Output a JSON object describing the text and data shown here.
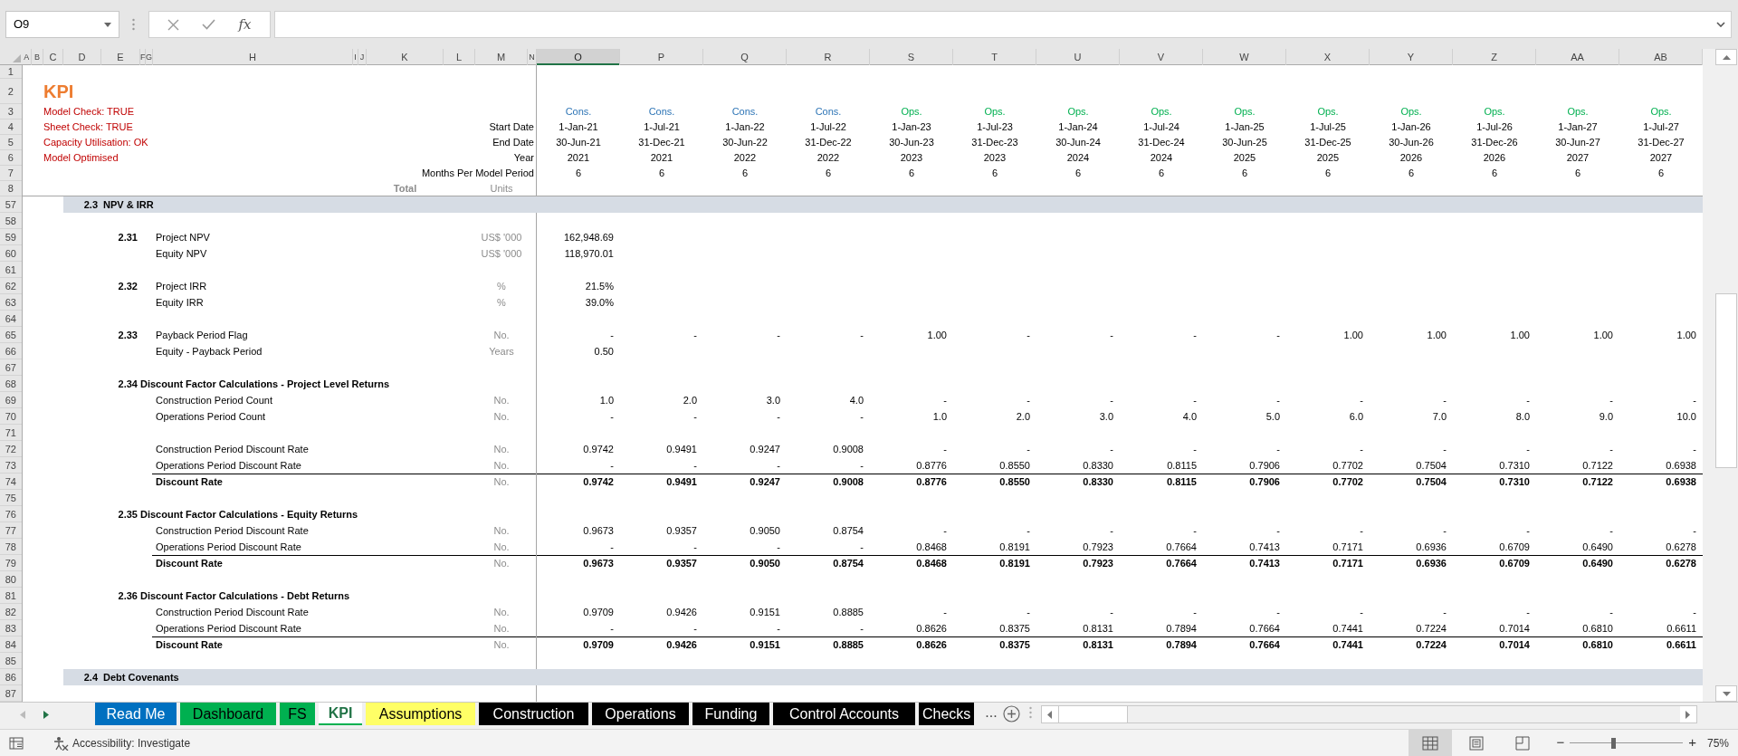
{
  "name_box": "O9",
  "formula_label": "fx",
  "columns": [
    {
      "letter": "A",
      "selected": false
    },
    {
      "letter": "B",
      "selected": false
    },
    {
      "letter": "C",
      "selected": false
    },
    {
      "letter": "D",
      "selected": false
    },
    {
      "letter": "E",
      "selected": false
    },
    {
      "letter": "F",
      "selected": false
    },
    {
      "letter": "G",
      "selected": false
    },
    {
      "letter": "H",
      "selected": false
    },
    {
      "letter": "I",
      "selected": false
    },
    {
      "letter": "J",
      "selected": false
    },
    {
      "letter": "K",
      "selected": false
    },
    {
      "letter": "L",
      "selected": false
    },
    {
      "letter": "M",
      "selected": false
    },
    {
      "letter": "N",
      "selected": false
    },
    {
      "letter": "O",
      "selected": true
    },
    {
      "letter": "P",
      "selected": false
    },
    {
      "letter": "Q",
      "selected": false
    },
    {
      "letter": "R",
      "selected": false
    },
    {
      "letter": "S",
      "selected": false
    },
    {
      "letter": "T",
      "selected": false
    },
    {
      "letter": "U",
      "selected": false
    },
    {
      "letter": "V",
      "selected": false
    },
    {
      "letter": "W",
      "selected": false
    },
    {
      "letter": "X",
      "selected": false
    },
    {
      "letter": "Y",
      "selected": false
    },
    {
      "letter": "Z",
      "selected": false
    },
    {
      "letter": "AA",
      "selected": false
    },
    {
      "letter": "AB",
      "selected": false
    }
  ],
  "frozen_rows": [
    "1",
    "2",
    "3",
    "4",
    "5",
    "6",
    "7",
    "8"
  ],
  "sheet_title": "KPI",
  "status_checks": [
    "Model Check: TRUE",
    "Sheet Check: TRUE",
    "Capacity Utilisation: OK",
    "Model Optimised"
  ],
  "timeline_labels": [
    "Start Date",
    "End Date",
    "Year",
    "Months Per Model Period"
  ],
  "total_label": "Total",
  "units_label": "Units",
  "periods": [
    {
      "phase": "Cons.",
      "kind": "cons",
      "start": "1-Jan-21",
      "end": "30-Jun-21",
      "year": "2021",
      "months": "6"
    },
    {
      "phase": "Cons.",
      "kind": "cons",
      "start": "1-Jul-21",
      "end": "31-Dec-21",
      "year": "2021",
      "months": "6"
    },
    {
      "phase": "Cons.",
      "kind": "cons",
      "start": "1-Jan-22",
      "end": "30-Jun-22",
      "year": "2022",
      "months": "6"
    },
    {
      "phase": "Cons.",
      "kind": "cons",
      "start": "1-Jul-22",
      "end": "31-Dec-22",
      "year": "2022",
      "months": "6"
    },
    {
      "phase": "Ops.",
      "kind": "ops",
      "start": "1-Jan-23",
      "end": "30-Jun-23",
      "year": "2023",
      "months": "6"
    },
    {
      "phase": "Ops.",
      "kind": "ops",
      "start": "1-Jul-23",
      "end": "31-Dec-23",
      "year": "2023",
      "months": "6"
    },
    {
      "phase": "Ops.",
      "kind": "ops",
      "start": "1-Jan-24",
      "end": "30-Jun-24",
      "year": "2024",
      "months": "6"
    },
    {
      "phase": "Ops.",
      "kind": "ops",
      "start": "1-Jul-24",
      "end": "31-Dec-24",
      "year": "2024",
      "months": "6"
    },
    {
      "phase": "Ops.",
      "kind": "ops",
      "start": "1-Jan-25",
      "end": "30-Jun-25",
      "year": "2025",
      "months": "6"
    },
    {
      "phase": "Ops.",
      "kind": "ops",
      "start": "1-Jul-25",
      "end": "31-Dec-25",
      "year": "2025",
      "months": "6"
    },
    {
      "phase": "Ops.",
      "kind": "ops",
      "start": "1-Jan-26",
      "end": "30-Jun-26",
      "year": "2026",
      "months": "6"
    },
    {
      "phase": "Ops.",
      "kind": "ops",
      "start": "1-Jul-26",
      "end": "31-Dec-26",
      "year": "2026",
      "months": "6"
    },
    {
      "phase": "Ops.",
      "kind": "ops",
      "start": "1-Jan-27",
      "end": "30-Jun-27",
      "year": "2027",
      "months": "6"
    },
    {
      "phase": "Ops.",
      "kind": "ops",
      "start": "1-Jul-27",
      "end": "31-Dec-27",
      "year": "2027",
      "months": "6"
    }
  ],
  "rows": [
    {
      "number": "57",
      "kind": "section",
      "index": "2.3",
      "label": "NPV & IRR"
    },
    {
      "number": "58",
      "kind": "blank"
    },
    {
      "number": "59",
      "kind": "line",
      "index": "2.31",
      "label": "Project NPV",
      "unit": "US$ '000",
      "values": [
        "162,948.69"
      ]
    },
    {
      "number": "60",
      "kind": "line",
      "label": "Equity NPV",
      "unit": "US$ '000",
      "values": [
        "118,970.01"
      ]
    },
    {
      "number": "61",
      "kind": "blank"
    },
    {
      "number": "62",
      "kind": "line",
      "index": "2.32",
      "label": "Project IRR",
      "unit": "%",
      "values": [
        "21.5%"
      ]
    },
    {
      "number": "63",
      "kind": "line",
      "label": "Equity IRR",
      "unit": "%",
      "values": [
        "39.0%"
      ]
    },
    {
      "number": "64",
      "kind": "blank"
    },
    {
      "number": "65",
      "kind": "line",
      "index": "2.33",
      "label": "Payback Period Flag",
      "unit": "No.",
      "values": [
        "-",
        "-",
        "-",
        "-",
        "1.00",
        "-",
        "-",
        "-",
        "-",
        "1.00",
        "1.00",
        "1.00",
        "1.00",
        "1.00"
      ]
    },
    {
      "number": "66",
      "kind": "line",
      "label": "Equity - Payback Period",
      "unit": "Years",
      "values": [
        "0.50"
      ]
    },
    {
      "number": "67",
      "kind": "blank"
    },
    {
      "number": "68",
      "kind": "group",
      "index": "2.34",
      "label": "Discount Factor Calculations - Project Level Returns"
    },
    {
      "number": "69",
      "kind": "line",
      "label": "Construction Period Count",
      "unit": "No.",
      "values": [
        "1.0",
        "2.0",
        "3.0",
        "4.0",
        "-",
        "-",
        "-",
        "-",
        "-",
        "-",
        "-",
        "-",
        "-",
        "-"
      ]
    },
    {
      "number": "70",
      "kind": "line",
      "label": "Operations Period Count",
      "unit": "No.",
      "values": [
        "-",
        "-",
        "-",
        "-",
        "1.0",
        "2.0",
        "3.0",
        "4.0",
        "5.0",
        "6.0",
        "7.0",
        "8.0",
        "9.0",
        "10.0"
      ]
    },
    {
      "number": "71",
      "kind": "blank"
    },
    {
      "number": "72",
      "kind": "line",
      "label": "Construction Period Discount Rate",
      "unit": "No.",
      "values": [
        "0.9742",
        "0.9491",
        "0.9247",
        "0.9008",
        "-",
        "-",
        "-",
        "-",
        "-",
        "-",
        "-",
        "-",
        "-",
        "-"
      ]
    },
    {
      "number": "73",
      "kind": "line",
      "label": "Operations Period Discount Rate",
      "unit": "No.",
      "values": [
        "-",
        "-",
        "-",
        "-",
        "0.8776",
        "0.8550",
        "0.8330",
        "0.8115",
        "0.7906",
        "0.7702",
        "0.7504",
        "0.7310",
        "0.7122",
        "0.6938"
      ]
    },
    {
      "number": "74",
      "kind": "total",
      "label": "Discount Rate",
      "unit": "No.",
      "values": [
        "0.9742",
        "0.9491",
        "0.9247",
        "0.9008",
        "0.8776",
        "0.8550",
        "0.8330",
        "0.8115",
        "0.7906",
        "0.7702",
        "0.7504",
        "0.7310",
        "0.7122",
        "0.6938"
      ]
    },
    {
      "number": "75",
      "kind": "blank"
    },
    {
      "number": "76",
      "kind": "group",
      "index": "2.35",
      "label": "Discount Factor Calculations - Equity Returns"
    },
    {
      "number": "77",
      "kind": "line",
      "label": "Construction Period Discount Rate",
      "unit": "No.",
      "values": [
        "0.9673",
        "0.9357",
        "0.9050",
        "0.8754",
        "-",
        "-",
        "-",
        "-",
        "-",
        "-",
        "-",
        "-",
        "-",
        "-"
      ]
    },
    {
      "number": "78",
      "kind": "line",
      "label": "Operations Period Discount Rate",
      "unit": "No.",
      "values": [
        "-",
        "-",
        "-",
        "-",
        "0.8468",
        "0.8191",
        "0.7923",
        "0.7664",
        "0.7413",
        "0.7171",
        "0.6936",
        "0.6709",
        "0.6490",
        "0.6278"
      ]
    },
    {
      "number": "79",
      "kind": "total",
      "label": "Discount Rate",
      "unit": "No.",
      "values": [
        "0.9673",
        "0.9357",
        "0.9050",
        "0.8754",
        "0.8468",
        "0.8191",
        "0.7923",
        "0.7664",
        "0.7413",
        "0.7171",
        "0.6936",
        "0.6709",
        "0.6490",
        "0.6278"
      ]
    },
    {
      "number": "80",
      "kind": "blank"
    },
    {
      "number": "81",
      "kind": "group",
      "index": "2.36",
      "label": "Discount Factor Calculations - Debt Returns"
    },
    {
      "number": "82",
      "kind": "line",
      "label": "Construction Period Discount Rate",
      "unit": "No.",
      "values": [
        "0.9709",
        "0.9426",
        "0.9151",
        "0.8885",
        "-",
        "-",
        "-",
        "-",
        "-",
        "-",
        "-",
        "-",
        "-",
        "-"
      ]
    },
    {
      "number": "83",
      "kind": "line",
      "label": "Operations Period Discount Rate",
      "unit": "No.",
      "values": [
        "-",
        "-",
        "-",
        "-",
        "0.8626",
        "0.8375",
        "0.8131",
        "0.7894",
        "0.7664",
        "0.7441",
        "0.7224",
        "0.7014",
        "0.6810",
        "0.6611"
      ]
    },
    {
      "number": "84",
      "kind": "total",
      "label": "Discount Rate",
      "unit": "No.",
      "values": [
        "0.9709",
        "0.9426",
        "0.9151",
        "0.8885",
        "0.8626",
        "0.8375",
        "0.8131",
        "0.7894",
        "0.7664",
        "0.7441",
        "0.7224",
        "0.7014",
        "0.6810",
        "0.6611"
      ]
    },
    {
      "number": "85",
      "kind": "blank"
    },
    {
      "number": "86",
      "kind": "section",
      "index": "2.4",
      "label": "Debt Covenants"
    },
    {
      "number": "87",
      "kind": "blank"
    }
  ],
  "sheet_tabs": [
    {
      "label": "Read Me",
      "color": "#0070c0",
      "selected": false
    },
    {
      "label": "Dashboard",
      "color": "#00b050",
      "selected": false
    },
    {
      "label": "FS",
      "color": "#00b050",
      "selected": false
    },
    {
      "label": "KPI",
      "color": "#00b050",
      "selected": true
    },
    {
      "label": "Assumptions",
      "color": "#ffff66",
      "selected": false
    },
    {
      "label": "Construction",
      "color": "#000000",
      "selected": false
    },
    {
      "label": "Operations",
      "color": "#000000",
      "selected": false
    },
    {
      "label": "Funding",
      "color": "#000000",
      "selected": false
    },
    {
      "label": "Control Accounts",
      "color": "#000000",
      "selected": false
    },
    {
      "label": "Checks",
      "color": "#000000",
      "selected": false
    }
  ],
  "tab_overflow": "...",
  "status_text": "Accessibility: Investigate",
  "view_buttons": [
    {
      "kind": "normal",
      "selected": true
    },
    {
      "kind": "page_layout",
      "selected": false
    },
    {
      "kind": "page_break",
      "selected": false
    }
  ],
  "zoom": {
    "out": "−",
    "in": "+",
    "level": 0.37,
    "reading": "75%"
  }
}
